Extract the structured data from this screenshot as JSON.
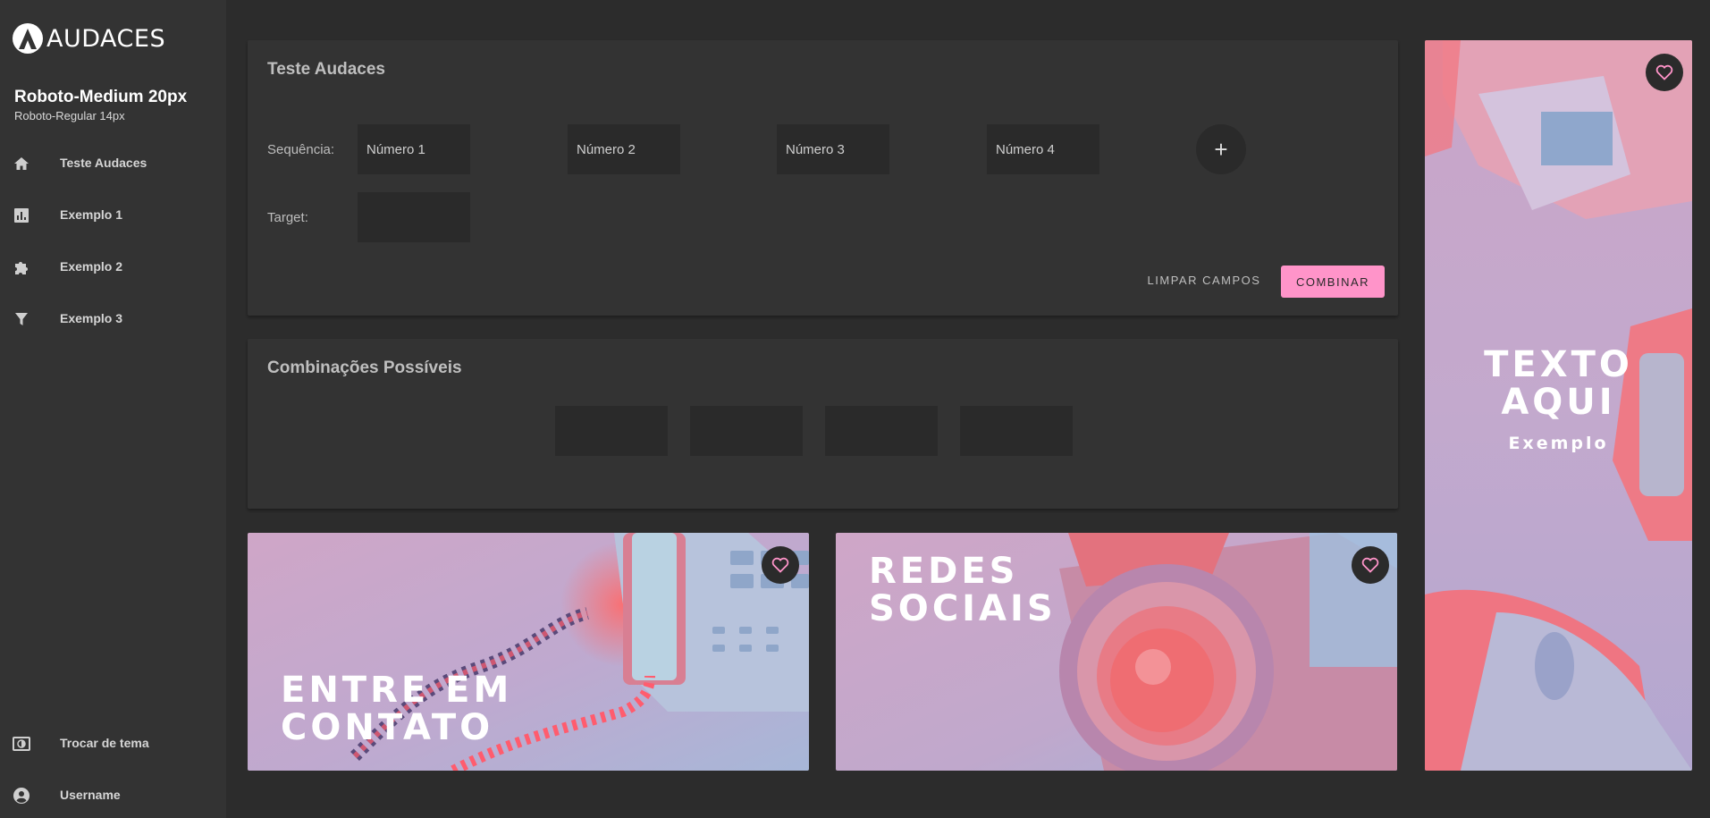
{
  "brand": {
    "logo_text": "AUDACES"
  },
  "profile": {
    "title": "Roboto-Medium 20px",
    "subtitle": "Roboto-Regular 14px"
  },
  "sidebar": {
    "items": [
      {
        "label": "Teste Audaces",
        "icon": "home-icon"
      },
      {
        "label": "Exemplo 1",
        "icon": "bar-chart-icon"
      },
      {
        "label": "Exemplo 2",
        "icon": "puzzle-icon"
      },
      {
        "label": "Exemplo 3",
        "icon": "filter-icon"
      }
    ],
    "bottom": [
      {
        "label": "Trocar de tema",
        "icon": "theme-toggle-icon"
      },
      {
        "label": "Username",
        "icon": "account-icon"
      }
    ]
  },
  "form": {
    "title": "Teste Audaces",
    "sequence_label": "Sequência:",
    "target_label": "Target:",
    "placeholders": [
      "Número 1",
      "Número 2",
      "Número 3",
      "Número 4"
    ],
    "target_value": "",
    "add_button": "+",
    "clear_button": "LIMPAR CAMPOS",
    "combine_button": "COMBINAR"
  },
  "combinations": {
    "title": "Combinações Possíveis",
    "items": [
      "",
      "",
      "",
      ""
    ]
  },
  "tiles": {
    "contact": {
      "line1": "ENTRE EM",
      "line2": "CONTATO"
    },
    "social": {
      "line1": "REDES",
      "line2": "SOCIAIS"
    },
    "side": {
      "line1": "TEXTO",
      "line2": "AQUI",
      "sub": "Exemplo"
    }
  },
  "colors": {
    "accent": "#ff94c9",
    "background": "#2c2c2c",
    "panel": "#333333",
    "field": "#2a2a2a"
  }
}
